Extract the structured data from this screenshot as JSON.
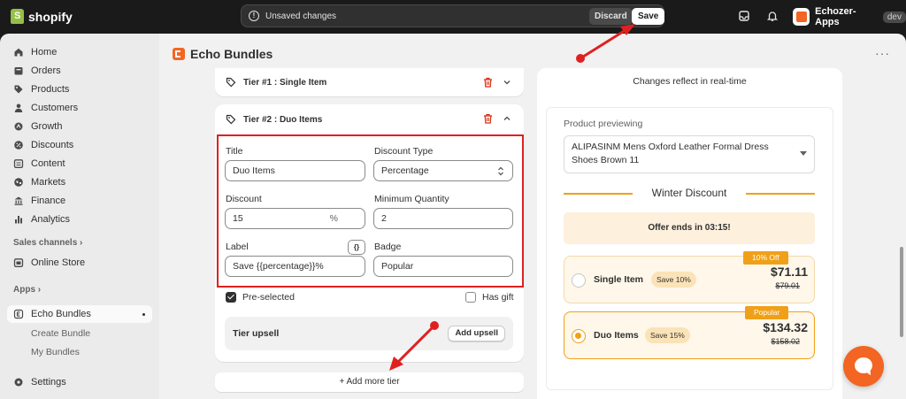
{
  "topbar": {
    "brand": "shopify",
    "unsaved_text": "Unsaved changes",
    "discard_label": "Discard",
    "save_label": "Save",
    "store_name": "Echozer-Apps",
    "dev_badge": "dev"
  },
  "sidebar": {
    "items": [
      {
        "label": "Home",
        "icon": "home-icon"
      },
      {
        "label": "Orders",
        "icon": "orders-icon"
      },
      {
        "label": "Products",
        "icon": "tag-icon"
      },
      {
        "label": "Customers",
        "icon": "person-icon"
      },
      {
        "label": "Growth",
        "icon": "growth-icon"
      },
      {
        "label": "Discounts",
        "icon": "discount-icon"
      },
      {
        "label": "Content",
        "icon": "content-icon"
      },
      {
        "label": "Markets",
        "icon": "globe-icon"
      },
      {
        "label": "Finance",
        "icon": "bank-icon"
      },
      {
        "label": "Analytics",
        "icon": "chart-icon"
      }
    ],
    "sales_channels_label": "Sales channels",
    "online_store_label": "Online Store",
    "apps_label": "Apps",
    "echo_bundles_label": "Echo Bundles",
    "create_bundle_label": "Create Bundle",
    "my_bundles_label": "My Bundles",
    "settings_label": "Settings"
  },
  "main": {
    "page_title": "Echo Bundles",
    "tier1_title": "Tier #1 : Single Item",
    "tier2_title": "Tier #2 : Duo Items",
    "form": {
      "title_label": "Title",
      "title_value": "Duo Items",
      "discount_type_label": "Discount Type",
      "discount_type_value": "Percentage",
      "discount_label": "Discount",
      "discount_value": "15",
      "discount_suffix": "%",
      "min_qty_label": "Minimum Quantity",
      "min_qty_value": "2",
      "label_label": "Label",
      "label_value": "Save {{percentage}}%",
      "braces_label": "{}",
      "badge_label": "Badge",
      "badge_value": "Popular"
    },
    "preselected_label": "Pre-selected",
    "has_gift_label": "Has gift",
    "tier_upsell_label": "Tier upsell",
    "add_upsell_label": "Add upsell",
    "add_more_tier_label": "Add more tier"
  },
  "preview": {
    "caption": "Changes reflect in real-time",
    "product_label": "Product previewing",
    "product_name": "ALIPASINM Mens Oxford Leather Formal Dress Shoes Brown 11",
    "discount_title": "Winter Discount",
    "offer_text": "Offer ends in 03:15!",
    "bundles": [
      {
        "name": "Single Item",
        "save": "Save 10%",
        "price": "$71.11",
        "old_price": "$79.01",
        "ribbon": "10% Off",
        "selected": false
      },
      {
        "name": "Duo Items",
        "save": "Save 15%",
        "price": "$134.32",
        "old_price": "$158.02",
        "ribbon": "Popular",
        "selected": true
      }
    ]
  },
  "colors": {
    "accent": "#f0a018",
    "brand_orange": "#f26522",
    "highlight_red": "#e02020"
  }
}
